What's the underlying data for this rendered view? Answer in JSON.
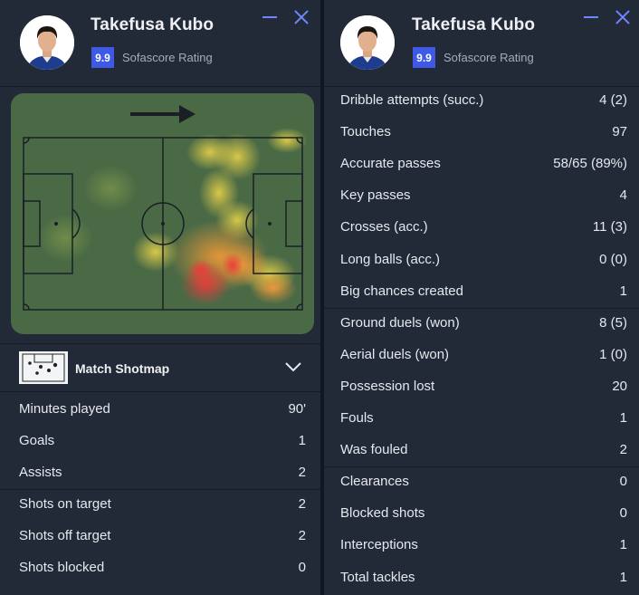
{
  "player": {
    "name": "Takefusa Kubo",
    "rating": "9.9",
    "rating_label": "Sofascore Rating"
  },
  "shotmap": {
    "label": "Match Shotmap"
  },
  "left_stats": [
    {
      "label": "Minutes played",
      "value": "90'"
    },
    {
      "label": "Goals",
      "value": "1"
    },
    {
      "label": "Assists",
      "value": "2"
    },
    {
      "label": "Shots on target",
      "value": "2"
    },
    {
      "label": "Shots off target",
      "value": "2"
    },
    {
      "label": "Shots blocked",
      "value": "0"
    }
  ],
  "right_stats": [
    {
      "label": "Dribble attempts (succ.)",
      "value": "4 (2)"
    },
    {
      "label": "Touches",
      "value": "97"
    },
    {
      "label": "Accurate passes",
      "value": "58/65 (89%)"
    },
    {
      "label": "Key passes",
      "value": "4"
    },
    {
      "label": "Crosses (acc.)",
      "value": "11 (3)"
    },
    {
      "label": "Long balls (acc.)",
      "value": "0 (0)"
    },
    {
      "label": "Big chances created",
      "value": "1"
    },
    {
      "label": "Ground duels (won)",
      "value": "8 (5)"
    },
    {
      "label": "Aerial duels (won)",
      "value": "1 (0)"
    },
    {
      "label": "Possession lost",
      "value": "20"
    },
    {
      "label": "Fouls",
      "value": "1"
    },
    {
      "label": "Was fouled",
      "value": "2"
    },
    {
      "label": "Clearances",
      "value": "0"
    },
    {
      "label": "Blocked shots",
      "value": "0"
    },
    {
      "label": "Interceptions",
      "value": "1"
    },
    {
      "label": "Total tackles",
      "value": "1"
    }
  ],
  "colors": {
    "accent": "#3e59e6",
    "icon_blue": "#6f86ff",
    "panel_bg": "#222a37",
    "pitch_green": "#4a6a46"
  }
}
